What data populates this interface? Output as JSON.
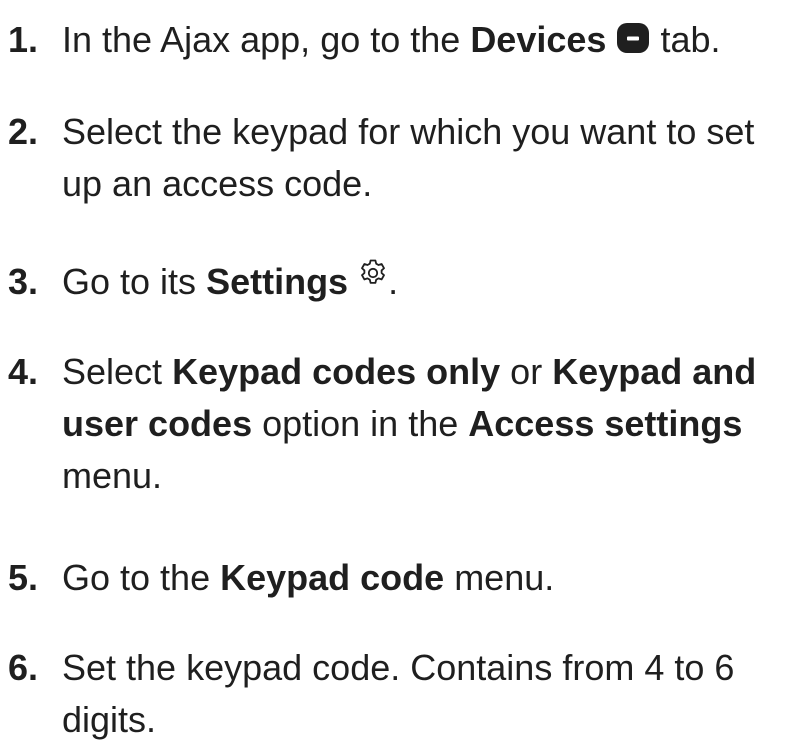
{
  "steps": [
    {
      "number": "1.",
      "parts": [
        "In the Ajax app, go to the ",
        "Devices",
        " tab."
      ],
      "icon": "devices-icon"
    },
    {
      "number": "2.",
      "line1": "Select the keypad for which you want to set",
      "line2": "up an access code."
    },
    {
      "number": "3.",
      "parts": [
        "Go to its ",
        "Settings",
        "."
      ],
      "icon": "gear-icon"
    },
    {
      "number": "4.",
      "parts": [
        "Select ",
        "Keypad codes only",
        " or ",
        "Keypad and",
        "user codes",
        " option in the ",
        "Access settings",
        "menu."
      ]
    },
    {
      "number": "5.",
      "parts": [
        "Go to the ",
        "Keypad code",
        " menu."
      ]
    },
    {
      "number": "6.",
      "line1": "Set the keypad code. Contains from 4 to 6",
      "line2": "digits."
    }
  ]
}
